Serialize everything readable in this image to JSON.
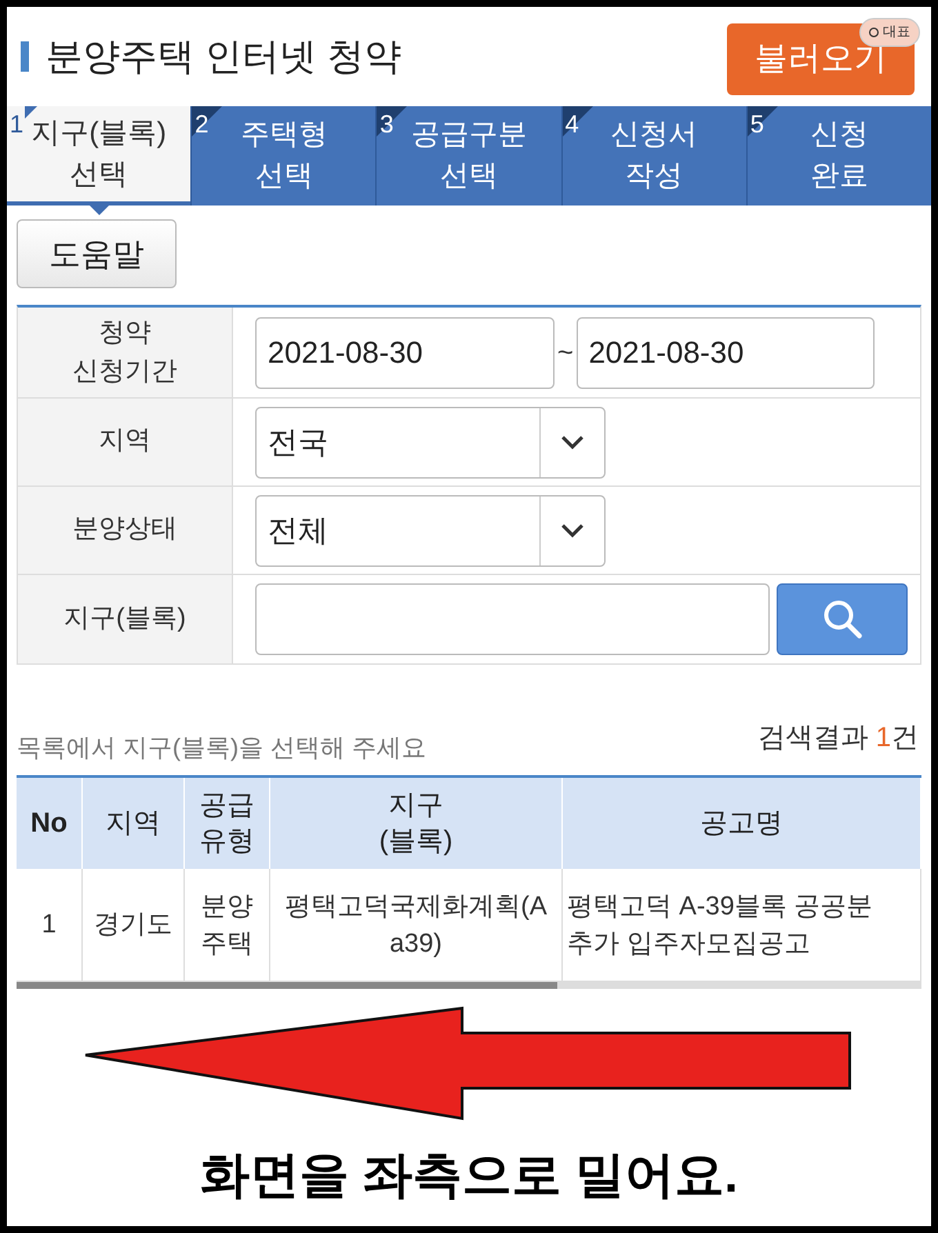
{
  "header": {
    "title": "분양주택 인터넷 청약",
    "load_button": "불러오기",
    "badge": "대표"
  },
  "steps": [
    {
      "number": "1",
      "lines": [
        "지구(블록)",
        "선택"
      ],
      "selected": true
    },
    {
      "number": "2",
      "lines": [
        "주택형",
        "선택"
      ],
      "selected": false
    },
    {
      "number": "3",
      "lines": [
        "공급구분",
        "선택"
      ],
      "selected": false
    },
    {
      "number": "4",
      "lines": [
        "신청서",
        "작성"
      ],
      "selected": false
    },
    {
      "number": "5",
      "lines": [
        "신청",
        "완료"
      ],
      "selected": false
    }
  ],
  "help_button": "도움말",
  "form": {
    "period": {
      "label": [
        "청약",
        "신청기간"
      ],
      "from": "2021-08-30",
      "separator": "~",
      "to": "2021-08-30"
    },
    "selects": [
      {
        "label": "지역",
        "value": "전국"
      },
      {
        "label": "분양상태",
        "value": "전체"
      }
    ],
    "district": {
      "label": "지구(블록)"
    }
  },
  "instruction": "목록에서 지구(블록)을 선택해 주세요",
  "result": {
    "prefix": "검색결과",
    "count": "1",
    "suffix": "건"
  },
  "table": {
    "columns": [
      "No",
      "지역",
      "공급\n유형",
      "지구\n(블록)",
      "공고명"
    ],
    "rows": [
      [
        "1",
        "경기도",
        "분양\n주택",
        "평택고덕국제화계획(A\na39)",
        "평택고덕 A-39블록 공공분\n추가 입주자모집공고"
      ]
    ]
  },
  "annotation": "화면을 좌측으로 밀어요."
}
